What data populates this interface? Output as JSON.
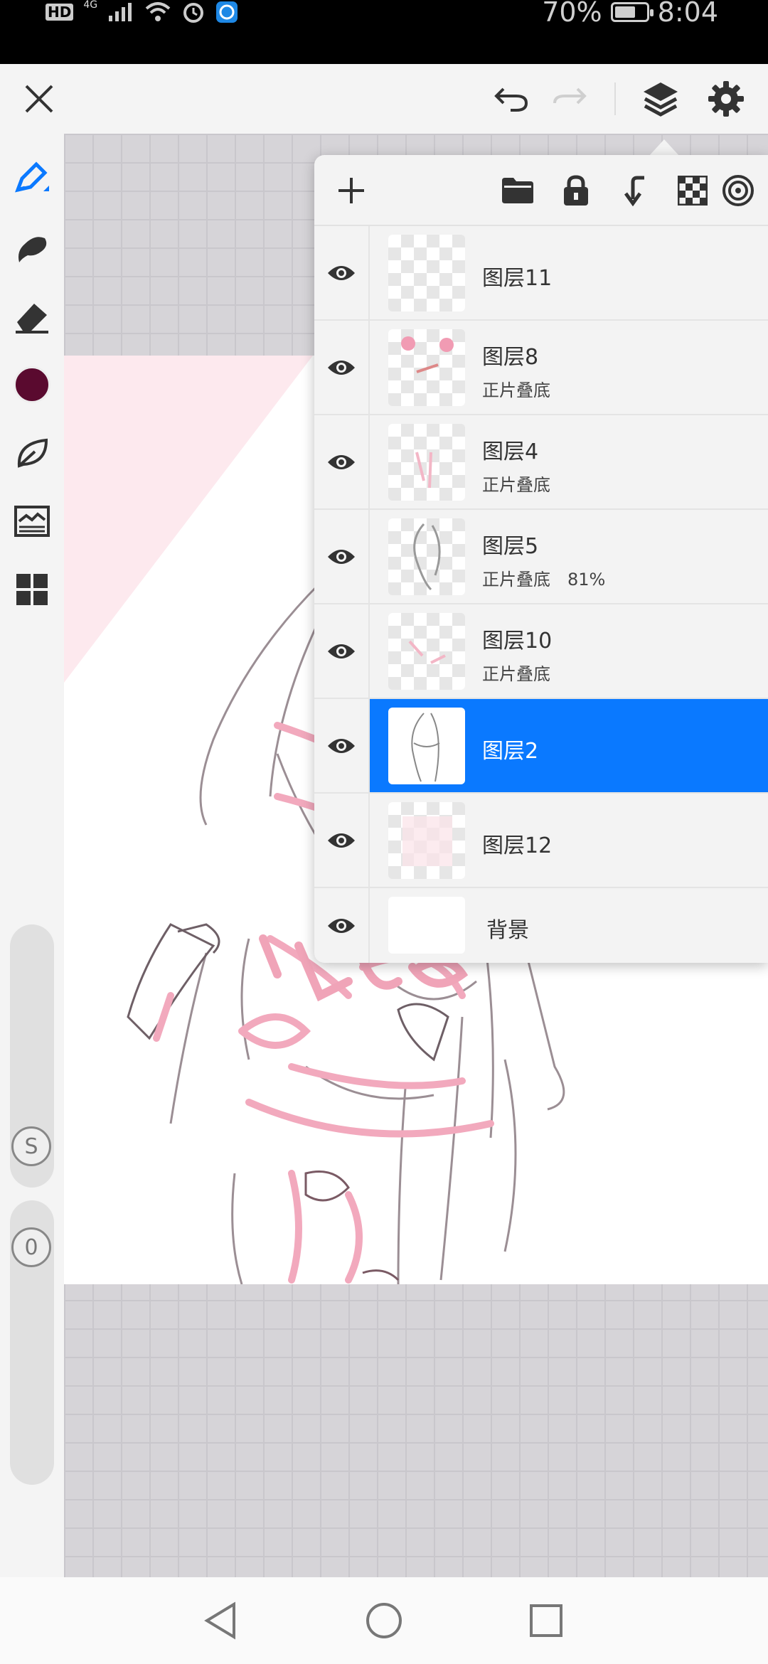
{
  "status_bar": {
    "left_text": "HD",
    "network": "4G",
    "battery": "70%",
    "time": "8:04"
  },
  "topbar": {
    "close": "close",
    "undo": "undo",
    "redo": "redo",
    "layers": "layers",
    "settings": "settings"
  },
  "left_tools": {
    "color": "#5a0a2f",
    "size_label": "S",
    "opacity_label": "0"
  },
  "layers_panel": {
    "layers": [
      {
        "name": "图层11",
        "mode": "",
        "opacity": "",
        "selected": false
      },
      {
        "name": "图层8",
        "mode": "正片叠底",
        "opacity": "",
        "selected": false
      },
      {
        "name": "图层4",
        "mode": "正片叠底",
        "opacity": "",
        "selected": false
      },
      {
        "name": "图层5",
        "mode": "正片叠底",
        "opacity": "81%",
        "selected": false
      },
      {
        "name": "图层10",
        "mode": "正片叠底",
        "opacity": "",
        "selected": false
      },
      {
        "name": "图层2",
        "mode": "",
        "opacity": "",
        "selected": true
      },
      {
        "name": "图层12",
        "mode": "",
        "opacity": "",
        "selected": false
      },
      {
        "name": "背景",
        "mode": "",
        "opacity": "",
        "selected": false
      }
    ]
  },
  "colors": {
    "accent": "#0a79ff",
    "sketch_pink": "#f4b8c8",
    "sketch_dark": "#7a5a64"
  }
}
